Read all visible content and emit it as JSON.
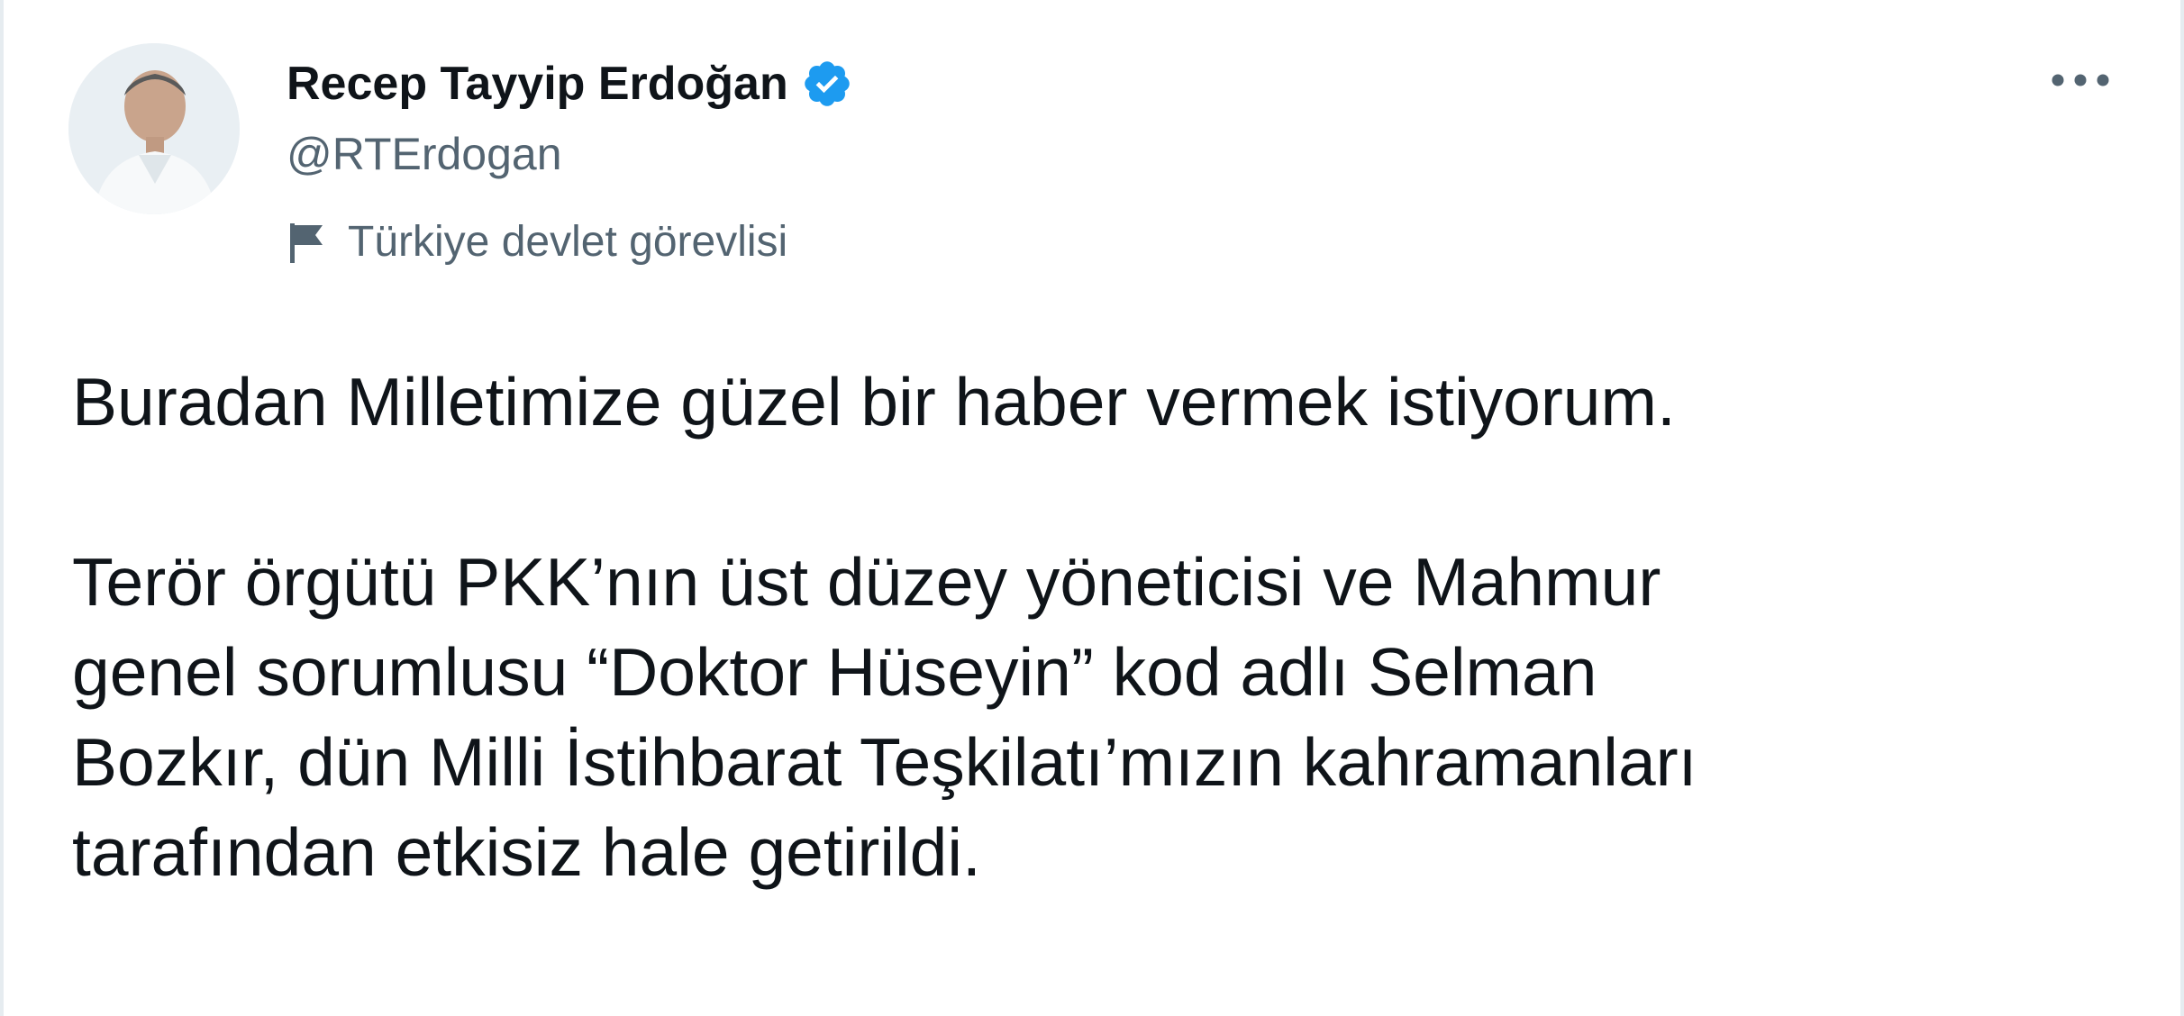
{
  "tweet": {
    "author": {
      "display_name": "Recep Tayyip Erdoğan",
      "handle": "@RTErdogan",
      "verified_icon": "verified-badge-icon",
      "label": "Türkiye devlet görevlisi",
      "label_icon": "flag-icon"
    },
    "more_icon": "more-options-icon",
    "text_lines": [
      "Buradan Milletimize güzel bir haber vermek istiyorum.",
      "Terör örgütü PKK’nın üst düzey yöneticisi ve Mahmur",
      "genel sorumlusu “Doktor Hüseyin” kod adlı Selman",
      "Bozkır, dün Milli İstihbarat Teşkilatı’mızın kahramanları",
      "tarafından etkisiz hale getirildi."
    ]
  },
  "colors": {
    "verified_blue": "#1d9bf0",
    "secondary_text": "#536471",
    "primary_text": "#0f1419"
  }
}
